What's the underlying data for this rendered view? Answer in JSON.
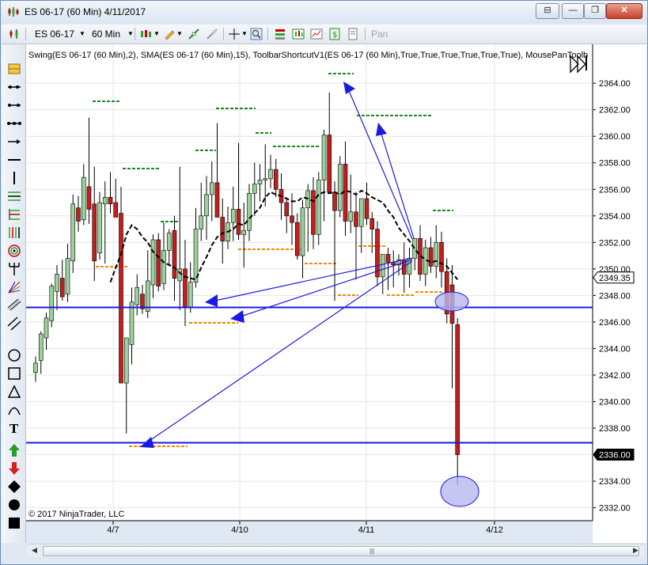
{
  "window": {
    "title": "ES 06-17 (60 Min)  4/11/2017",
    "minimize_label": "—",
    "restore_label": "❐",
    "close_label": "✕",
    "extra_label": "⊟"
  },
  "toolbar": {
    "instrument": "ES 06-17",
    "interval": "60 Min",
    "pan_label": "Pan"
  },
  "indicator_label": "Swing(ES 06-17 (60 Min),2), SMA(ES 06-17 (60 Min),15), ToolbarShortcutV1(ES 06-17 (60 Min),True,True,True,True,True,True), MousePanToolb",
  "copyright": "© 2017 NinjaTrader, LLC",
  "left_tools": [
    "bar-icon",
    "ray-line-icon",
    "extended-line-icon",
    "segment-line-icon",
    "arrow-line-icon",
    "horizontal-line-icon",
    "vertical-line-icon",
    "fib-icon",
    "fib-extension-icon",
    "fib-time-icon",
    "fib-circle-icon",
    "andrews-pitchfork-icon",
    "gann-fan-icon",
    "regression-channel-icon",
    "trend-channel-icon",
    "ellipse-icon",
    "rectangle-icon",
    "triangle-icon",
    "arc-icon",
    "text-icon",
    "arrow-up-icon",
    "arrow-down-icon",
    "diamond-icon",
    "dot-icon",
    "square-icon"
  ],
  "chart_data": {
    "type": "candlestick",
    "instrument": "ES 06-17",
    "y_axis": {
      "ticks": [
        "2364.00",
        "2362.00",
        "2360.00",
        "2358.00",
        "2356.00",
        "2354.00",
        "2352.00",
        "2350.00",
        "2348.00",
        "2346.00",
        "2344.00",
        "2342.00",
        "2340.00",
        "2338.00",
        "2336.00",
        "2334.00",
        "2332.00"
      ],
      "range": [
        2331.5,
        2365.5
      ]
    },
    "x_axis": {
      "ticks": [
        "4/7",
        "4/10",
        "4/11",
        "4/12"
      ]
    },
    "price_markers": [
      {
        "label": "2349.35",
        "value": 2349.35,
        "style": "outlined"
      },
      {
        "label": "2336.00",
        "value": 2336.0,
        "style": "filled"
      }
    ],
    "horizontal_lines": [
      2347.1,
      2336.9
    ],
    "sma_period": 15,
    "candles_ohlc": [
      [
        2342.2,
        2343.4,
        2341.5,
        2342.9
      ],
      [
        2343.1,
        2345.3,
        2342.1,
        2345.1
      ],
      [
        2344.8,
        2346.7,
        2343.9,
        2346.3
      ],
      [
        2346.1,
        2348.9,
        2345.6,
        2348.7
      ],
      [
        2348.3,
        2350.3,
        2346.9,
        2349.6
      ],
      [
        2349.3,
        2350.7,
        2347.6,
        2347.9
      ],
      [
        2348.1,
        2351.9,
        2347.5,
        2350.8
      ],
      [
        2350.6,
        2355.6,
        2349.7,
        2354.9
      ],
      [
        2354.6,
        2355.5,
        2352.8,
        2353.6
      ],
      [
        2353.7,
        2357.9,
        2353.3,
        2356.9
      ],
      [
        2356.2,
        2361.4,
        2353.4,
        2354.5
      ],
      [
        2354.9,
        2357.7,
        2349.1,
        2350.6
      ],
      [
        2351.2,
        2355.8,
        2350.7,
        2355.0
      ],
      [
        2354.9,
        2356.6,
        2350.4,
        2355.4
      ],
      [
        2355.4,
        2357.3,
        2354.2,
        2354.9
      ],
      [
        2355.0,
        2356.8,
        2354.2,
        2353.9
      ],
      [
        2354.2,
        2356.2,
        2343.9,
        2341.4
      ],
      [
        2341.4,
        2343.0,
        2337.6,
        2344.8
      ],
      [
        2344.3,
        2348.6,
        2342.8,
        2347.5
      ],
      [
        2347.3,
        2349.6,
        2346.5,
        2348.6
      ],
      [
        2348.1,
        2348.8,
        2346.6,
        2347.0
      ],
      [
        2346.8,
        2351.4,
        2346.3,
        2349.1
      ],
      [
        2348.8,
        2352.6,
        2347.8,
        2352.2
      ],
      [
        2352.2,
        2352.7,
        2348.3,
        2348.7
      ],
      [
        2348.9,
        2353.5,
        2348.4,
        2351.4
      ],
      [
        2351.4,
        2353.0,
        2350.2,
        2352.7
      ],
      [
        2352.9,
        2354.0,
        2347.6,
        2349.3
      ],
      [
        2349.1,
        2357.7,
        2346.9,
        2350.0
      ],
      [
        2350.0,
        2352.2,
        2345.7,
        2347.1
      ],
      [
        2347.1,
        2350.5,
        2346.7,
        2349.0
      ],
      [
        2349.0,
        2354.6,
        2348.6,
        2353.0
      ],
      [
        2353.0,
        2356.5,
        2352.1,
        2354.0
      ],
      [
        2354.0,
        2357.0,
        2352.2,
        2355.6
      ],
      [
        2355.6,
        2358.1,
        2353.6,
        2356.5
      ],
      [
        2356.5,
        2361.0,
        2354.7,
        2353.9
      ],
      [
        2353.9,
        2355.3,
        2350.4,
        2352.1
      ],
      [
        2352.1,
        2354.7,
        2351.5,
        2353.5
      ],
      [
        2353.5,
        2356.2,
        2352.1,
        2354.5
      ],
      [
        2354.5,
        2359.5,
        2352.2,
        2352.6
      ],
      [
        2352.6,
        2355.0,
        2350.1,
        2352.9
      ],
      [
        2352.9,
        2356.4,
        2352.1,
        2355.7
      ],
      [
        2355.7,
        2358.0,
        2354.0,
        2356.4
      ],
      [
        2356.4,
        2357.9,
        2355.1,
        2356.7
      ],
      [
        2356.7,
        2359.4,
        2354.7,
        2356.8
      ],
      [
        2356.8,
        2358.6,
        2356.1,
        2357.5
      ],
      [
        2357.5,
        2358.3,
        2355.4,
        2356.0
      ],
      [
        2356.0,
        2357.2,
        2353.7,
        2355.0
      ],
      [
        2355.0,
        2355.4,
        2352.7,
        2354.0
      ],
      [
        2354.0,
        2355.7,
        2351.8,
        2353.5
      ],
      [
        2353.5,
        2354.2,
        2350.7,
        2351.0
      ],
      [
        2351.0,
        2355.2,
        2349.3,
        2354.6
      ],
      [
        2354.6,
        2356.4,
        2351.3,
        2355.9
      ],
      [
        2355.9,
        2356.9,
        2351.5,
        2352.6
      ],
      [
        2352.6,
        2357.3,
        2351.8,
        2356.7
      ],
      [
        2356.7,
        2360.5,
        2353.6,
        2360.1
      ],
      [
        2360.1,
        2363.3,
        2356.3,
        2355.8
      ],
      [
        2355.8,
        2356.6,
        2347.6,
        2354.4
      ],
      [
        2354.4,
        2358.5,
        2353.9,
        2357.9
      ],
      [
        2357.9,
        2359.6,
        2352.5,
        2353.6
      ],
      [
        2353.6,
        2357.1,
        2352.7,
        2354.3
      ],
      [
        2354.3,
        2355.8,
        2349.2,
        2353.2
      ],
      [
        2353.2,
        2354.5,
        2351.2,
        2355.3
      ],
      [
        2355.3,
        2356.5,
        2353.3,
        2353.8
      ],
      [
        2353.8,
        2354.3,
        2351.2,
        2353.0
      ],
      [
        2353.0,
        2353.6,
        2348.7,
        2349.4
      ],
      [
        2349.4,
        2350.9,
        2348.1,
        2351.1
      ],
      [
        2351.1,
        2351.6,
        2348.4,
        2350.5
      ],
      [
        2350.5,
        2351.4,
        2348.6,
        2350.3
      ],
      [
        2350.3,
        2351.1,
        2349.5,
        2350.7
      ],
      [
        2350.7,
        2352.0,
        2348.2,
        2349.6
      ],
      [
        2349.6,
        2351.6,
        2348.6,
        2350.8
      ],
      [
        2350.8,
        2352.1,
        2349.9,
        2352.3
      ],
      [
        2352.3,
        2353.3,
        2349.1,
        2349.6
      ],
      [
        2349.6,
        2352.2,
        2348.7,
        2351.6
      ],
      [
        2351.6,
        2352.4,
        2349.7,
        2350.2
      ],
      [
        2350.2,
        2353.3,
        2349.3,
        2352.0
      ],
      [
        2352.0,
        2352.8,
        2348.6,
        2349.8
      ],
      [
        2349.8,
        2350.8,
        2345.9,
        2346.6
      ],
      [
        2348.8,
        2350.3,
        2341.0,
        2345.9
      ],
      [
        2345.8,
        2346.3,
        2333.7,
        2336.0
      ]
    ],
    "sma_values": [
      null,
      null,
      null,
      null,
      null,
      null,
      null,
      null,
      null,
      null,
      null,
      null,
      null,
      null,
      2349.0,
      2350.1,
      2351.1,
      2352.6,
      2353.3,
      2353.0,
      2352.4,
      2352.0,
      2351.3,
      2350.9,
      2350.5,
      2350.3,
      2350.1,
      2349.7,
      2349.4,
      2349.3,
      2349.2,
      2350.1,
      2350.9,
      2351.8,
      2352.4,
      2352.7,
      2352.8,
      2353.0,
      2353.4,
      2353.3,
      2353.8,
      2354.2,
      2354.6,
      2355.4,
      2355.8,
      2355.6,
      2355.5,
      2355.3,
      2355.1,
      2355.1,
      2355.4,
      2355.3,
      2355.1,
      2355.6,
      2355.8,
      2355.7,
      2355.8,
      2355.6,
      2355.9,
      2355.8,
      2355.6,
      2355.9,
      2355.7,
      2355.4,
      2355.2,
      2355.0,
      2354.4,
      2353.9,
      2353.1,
      2352.6,
      2352.1,
      2351.5,
      2351.0,
      2350.7,
      2350.5,
      2350.6,
      2350.4,
      2350.2,
      2349.7,
      2349.2
    ]
  }
}
